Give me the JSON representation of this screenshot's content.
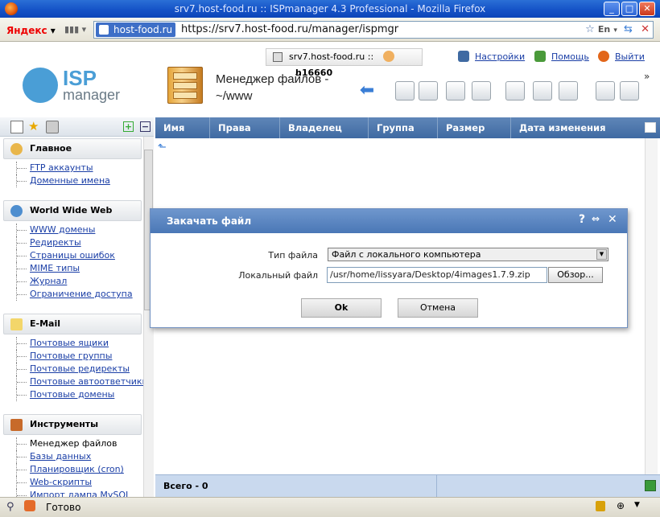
{
  "window": {
    "title": "srv7.host-food.ru :: ISPmanager 4.3 Professional - Mozilla Firefox"
  },
  "browser": {
    "search_engine": "Яндекс",
    "site_badge": "host-food.ru",
    "url": "https://srv7.host-food.ru/manager/ispmgr",
    "lang_button": "En"
  },
  "topbar": {
    "server": "srv7.host-food.ru ::",
    "user": "h16660",
    "settings": "Настройки",
    "help": "Помощь",
    "logout": "Выйти"
  },
  "logo": {
    "isp": "ISP",
    "manager": "manager"
  },
  "page": {
    "title_line1": "Менеджер файлов -",
    "title_line2": "~/www",
    "more": "»"
  },
  "sidebar": {
    "groups": [
      {
        "label": "Главное",
        "icon": "home-icon",
        "items": [
          {
            "label": "FTP аккаунты"
          },
          {
            "label": "Доменные имена"
          }
        ]
      },
      {
        "label": "World Wide Web",
        "icon": "globe-icon",
        "items": [
          {
            "label": "WWW домены"
          },
          {
            "label": "Редиректы"
          },
          {
            "label": "Страницы ошибок"
          },
          {
            "label": "MIME типы"
          },
          {
            "label": "Журнал"
          },
          {
            "label": "Ограничение доступа"
          }
        ]
      },
      {
        "label": "E-Mail",
        "icon": "mail-icon",
        "items": [
          {
            "label": "Почтовые ящики"
          },
          {
            "label": "Почтовые группы"
          },
          {
            "label": "Почтовые редиректы"
          },
          {
            "label": "Почтовые автоответчики"
          },
          {
            "label": "Почтовые домены"
          }
        ]
      },
      {
        "label": "Инструменты",
        "icon": "tools-icon",
        "items": [
          {
            "label": "Менеджер файлов"
          },
          {
            "label": "Базы данных"
          },
          {
            "label": "Планировщик (cron)"
          },
          {
            "label": "Web-скрипты"
          },
          {
            "label": "Импорт дампа MySQL"
          }
        ]
      }
    ]
  },
  "table": {
    "columns": [
      "Имя",
      "Права",
      "Владелец",
      "Группа",
      "Размер",
      "Дата изменения"
    ],
    "footer_total": "Всего - 0"
  },
  "dialog": {
    "title": "Закачать файл",
    "help": "?",
    "file_type_label": "Тип файла",
    "file_type_value": "Файл с локального компьютера",
    "local_file_label": "Локальный файл",
    "local_file_value": "/usr/home/lissyara/Desktop/4images1.7.9.zip",
    "browse": "Обзор...",
    "ok": "Ok",
    "cancel": "Отмена"
  },
  "status": {
    "text": "Готово"
  },
  "colors": {
    "header": "#3f6aa2",
    "dialog_head": "#4a77b6",
    "link": "#1a3ea6"
  }
}
